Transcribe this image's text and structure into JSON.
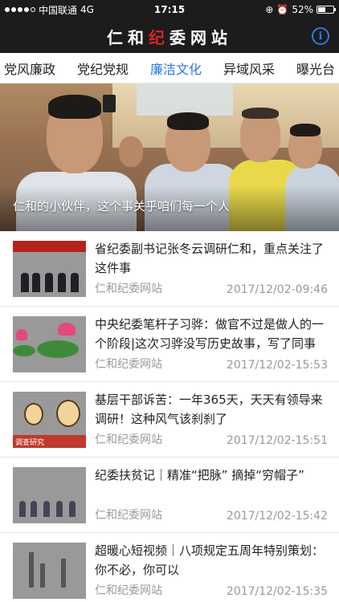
{
  "status_bar": {
    "carrier": "中国联通",
    "network": "4G",
    "time": "17:15",
    "battery_percent": "52%",
    "battery_level": 0.52
  },
  "header": {
    "title_part1": "仁和",
    "title_part2": "纪",
    "title_part3": "委网站",
    "info_icon": "info-icon",
    "accent_color": "#2a7ae2"
  },
  "tabs": [
    {
      "label": "党风廉政",
      "active": false
    },
    {
      "label": "党纪党规",
      "active": false
    },
    {
      "label": "廉洁文化",
      "active": true
    },
    {
      "label": "异域风采",
      "active": false
    },
    {
      "label": "曝光台",
      "active": false
    }
  ],
  "banner": {
    "caption": "仁和的小伙伴，这个事关乎咱们每一个人"
  },
  "news": [
    {
      "title": "省纪委副书记张冬云调研仁和，重点关注了这件事",
      "source": "仁和纪委网站",
      "time": "2017/12/02-09:46"
    },
    {
      "title": "中央纪委笔杆子习骅：做官不过是做人的一个阶段|这次习骅没写历史故事，写了同事",
      "source": "仁和纪委网站",
      "time": "2017/12/02-15:53"
    },
    {
      "title": "基层干部诉苦：一年365天，天天有领导来调研！这种风气该刹刹了",
      "source": "仁和纪委网站",
      "time": "2017/12/02-15:51",
      "thumb_text": "调查研究"
    },
    {
      "title": "纪委扶贫记｜精准“把脉” 摘掉“穷帽子”",
      "source": "仁和纪委网站",
      "time": "2017/12/02-15:42"
    },
    {
      "title": "超暖心短视频｜八项规定五周年特别策划：你不必，你可以",
      "source": "仁和纪委网站",
      "time": "2017/12/02-15:35"
    }
  ]
}
